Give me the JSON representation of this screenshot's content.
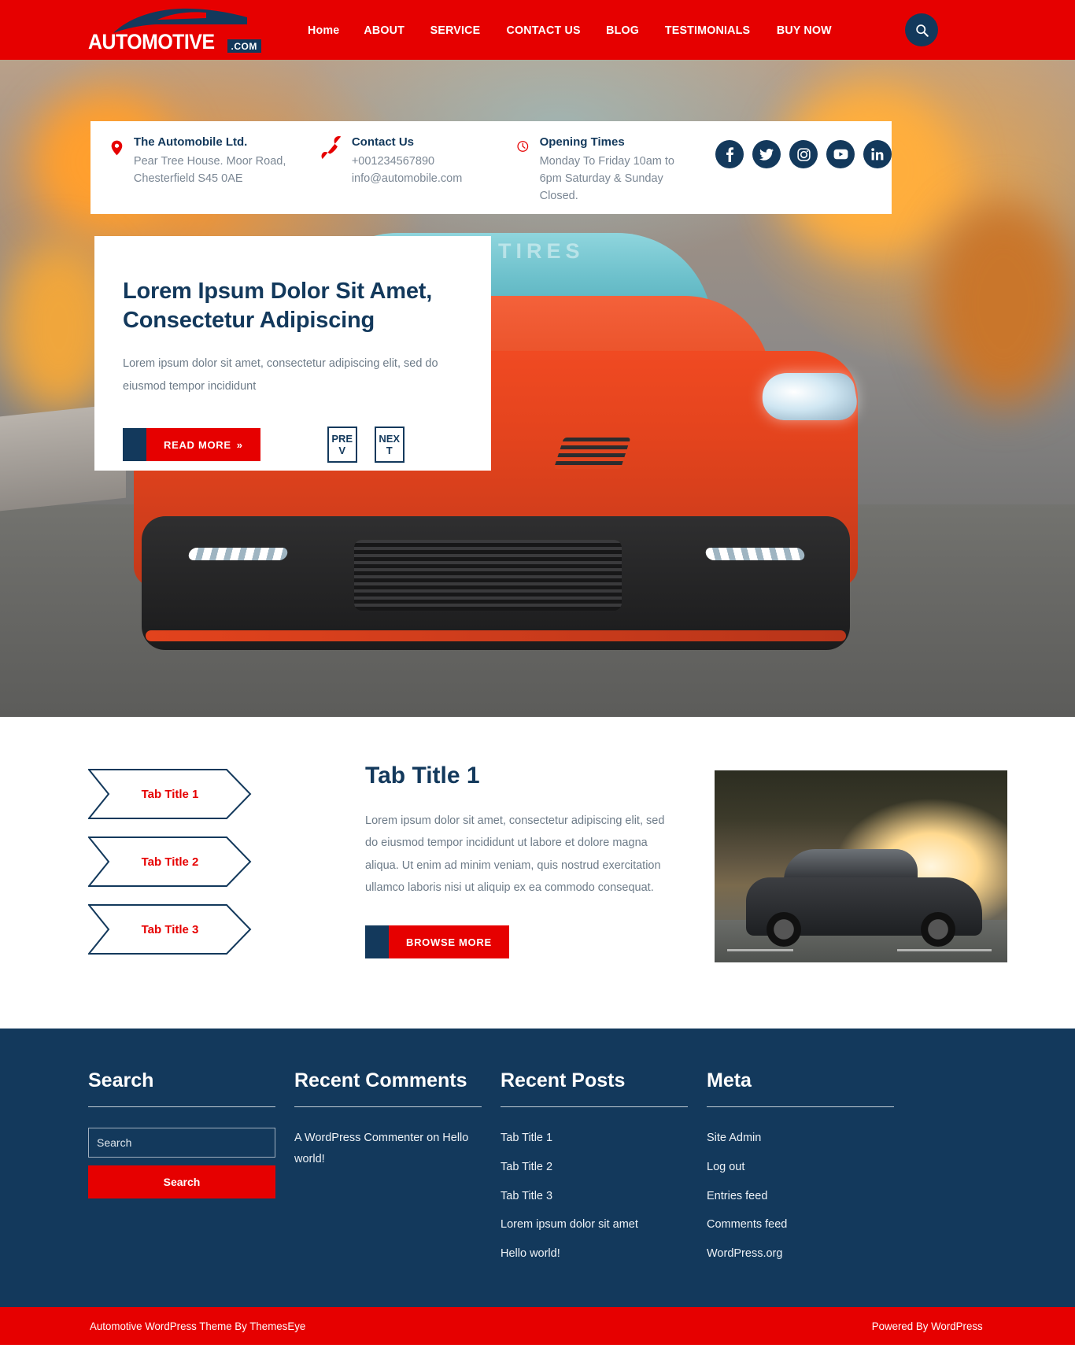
{
  "site": {
    "logo_word": "AUTOMOTIVE",
    "logo_suffix": ".COM"
  },
  "nav": {
    "items": [
      {
        "label": "Home",
        "name": "nav-home"
      },
      {
        "label": "ABOUT",
        "name": "nav-about"
      },
      {
        "label": "SERVICE",
        "name": "nav-service"
      },
      {
        "label": "CONTACT US",
        "name": "nav-contact-us"
      },
      {
        "label": "BLOG",
        "name": "nav-blog"
      },
      {
        "label": "TESTIMONIALS",
        "name": "nav-testimonials"
      },
      {
        "label": "BUY NOW",
        "name": "nav-buy-now"
      }
    ],
    "search_icon": "search-icon"
  },
  "contact_bar": {
    "address": {
      "icon": "location-pin-icon",
      "title": "The Automobile Ltd.",
      "text": "Pear Tree House. Moor Road, Chesterfield S45 0AE"
    },
    "phone": {
      "icon": "phone-icon",
      "title": "Contact Us",
      "line1": "+001234567890",
      "line2": "info@automobile.com"
    },
    "hours": {
      "icon": "clock-icon",
      "title": "Opening Times",
      "text": "Monday To Friday 10am to 6pm Saturday & Sunday Closed."
    },
    "socials": [
      {
        "name": "facebook-icon",
        "label": "Facebook"
      },
      {
        "name": "twitter-icon",
        "label": "Twitter"
      },
      {
        "name": "instagram-icon",
        "label": "Instagram"
      },
      {
        "name": "youtube-icon",
        "label": "YouTube"
      },
      {
        "name": "linkedin-icon",
        "label": "LinkedIn"
      }
    ]
  },
  "hero": {
    "title": "Lorem Ipsum Dolor Sit Amet, Consectetur Adipiscing",
    "description": "Lorem ipsum dolor sit amet, consectetur adipiscing elit, sed do eiusmod tempor incididunt",
    "read_more": "READ MORE",
    "read_more_arrow": "»",
    "prev": "PREV",
    "next": "NEXT",
    "windshield_text": "MOTIVE TIRES"
  },
  "tabs_section": {
    "tabs": [
      {
        "label": "Tab Title 1",
        "name": "tab-title-1"
      },
      {
        "label": "Tab Title 2",
        "name": "tab-title-2"
      },
      {
        "label": "Tab Title 3",
        "name": "tab-title-3"
      }
    ],
    "active_title": "Tab Title 1",
    "body": "Lorem ipsum dolor sit amet, consectetur adipiscing elit, sed do eiusmod tempor incididunt ut labore et dolore magna aliqua. Ut enim ad minim veniam, quis nostrud exercitation ullamco laboris nisi ut aliquip ex ea commodo consequat.",
    "browse_more": "BROWSE MORE"
  },
  "footer": {
    "search": {
      "heading": "Search",
      "placeholder": "Search",
      "button": "Search"
    },
    "recent_comments": {
      "heading": "Recent Comments",
      "text": "A WordPress Commenter on Hello world!"
    },
    "recent_posts": {
      "heading": "Recent Posts",
      "items": [
        "Tab Title 1",
        "Tab Title 2",
        "Tab Title 3",
        "Lorem ipsum dolor sit amet",
        "Hello world!"
      ]
    },
    "meta": {
      "heading": "Meta",
      "items": [
        "Site Admin",
        "Log out",
        "Entries feed",
        "Comments feed",
        "WordPress.org"
      ]
    }
  },
  "bottom_bar": {
    "left": "Automotive WordPress Theme By ThemesEye",
    "right": "Powered By WordPress"
  },
  "colors": {
    "brand_red": "#e60000",
    "navy": "#13395c",
    "body_text": "#6d7b88"
  }
}
